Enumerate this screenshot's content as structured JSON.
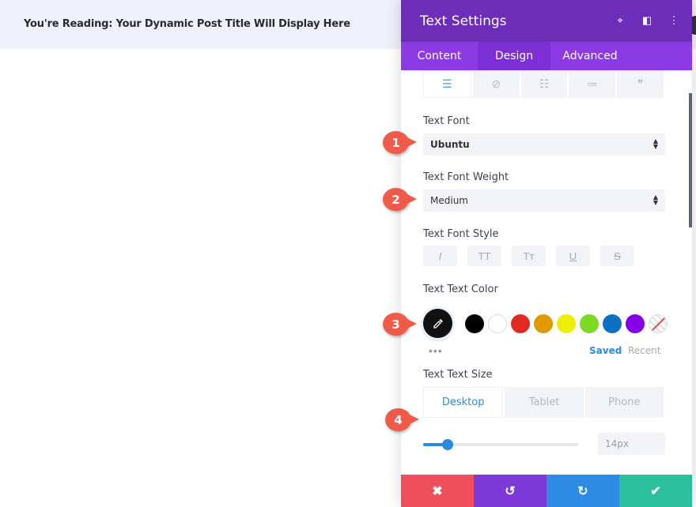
{
  "page": {
    "reading_text": "You're Reading: Your Dynamic Post Title Will Display Here"
  },
  "panel": {
    "title": "Text Settings",
    "header_icons": [
      "target-icon",
      "sidebar-layout-icon",
      "more-vertical-icon"
    ],
    "tabs": [
      {
        "label": "Content",
        "active": false
      },
      {
        "label": "Design",
        "active": true
      },
      {
        "label": "Advanced",
        "active": false
      }
    ],
    "text_tools": [
      "align-left-icon",
      "link-off-icon",
      "unordered-list-icon",
      "ordered-list-icon",
      "quote-icon"
    ],
    "text_font": {
      "label": "Text Font",
      "value": "Ubuntu"
    },
    "text_font_weight": {
      "label": "Text Font Weight",
      "value": "Medium"
    },
    "text_font_style": {
      "label": "Text Font Style",
      "buttons": [
        "I",
        "TT",
        "Tт",
        "U",
        "S"
      ]
    },
    "text_color": {
      "label": "Text Text Color",
      "selected": "#111111",
      "swatches": [
        "#000000",
        "#ffffff",
        "#e02b20",
        "#e09900",
        "#edf000",
        "#7cda24",
        "#0c71c3",
        "#8300e9"
      ],
      "more": "•••",
      "saved_label": "Saved",
      "recent_label": "Recent"
    },
    "text_size": {
      "label": "Text Text Size",
      "devices": [
        {
          "label": "Desktop",
          "active": true
        },
        {
          "label": "Tablet",
          "active": false
        },
        {
          "label": "Phone",
          "active": false
        }
      ],
      "value": "14px",
      "slider_fraction": 0.16
    },
    "footer": [
      "close-icon",
      "undo-icon",
      "redo-icon",
      "check-icon"
    ]
  },
  "annotations": [
    "1",
    "2",
    "3",
    "4"
  ],
  "colors": {
    "header": "#6c2eb9",
    "tabs": "#8c3be4",
    "accent": "#2e89e0",
    "badge": "#ef5b48"
  }
}
